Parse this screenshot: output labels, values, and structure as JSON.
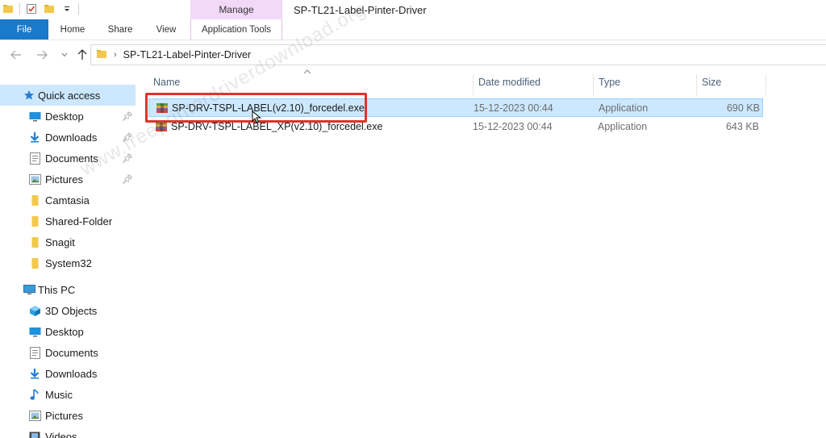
{
  "window": {
    "title": "SP-TL21-Label-Pinter-Driver",
    "context_tab_group": "Manage"
  },
  "ribbon": {
    "tabs": [
      {
        "label": "File"
      },
      {
        "label": "Home"
      },
      {
        "label": "Share"
      },
      {
        "label": "View"
      },
      {
        "label": "Application Tools"
      }
    ]
  },
  "address_bar": {
    "path": [
      "SP-TL21-Label-Pinter-Driver"
    ]
  },
  "nav_pane": {
    "quick_access": {
      "label": "Quick access"
    },
    "quick_items": [
      {
        "label": "Desktop",
        "icon": "desktop-icon",
        "pinned": true
      },
      {
        "label": "Downloads",
        "icon": "downloads-icon",
        "pinned": true
      },
      {
        "label": "Documents",
        "icon": "documents-icon",
        "pinned": true
      },
      {
        "label": "Pictures",
        "icon": "pictures-icon",
        "pinned": true
      },
      {
        "label": "Camtasia",
        "icon": "folder-icon",
        "pinned": false
      },
      {
        "label": "Shared-Folder",
        "icon": "folder-icon",
        "pinned": false
      },
      {
        "label": "Snagit",
        "icon": "folder-icon",
        "pinned": false
      },
      {
        "label": "System32",
        "icon": "folder-icon",
        "pinned": false
      }
    ],
    "this_pc": {
      "label": "This PC"
    },
    "pc_items": [
      {
        "label": "3D Objects",
        "icon": "3d-objects-icon"
      },
      {
        "label": "Desktop",
        "icon": "desktop-icon"
      },
      {
        "label": "Documents",
        "icon": "documents-icon"
      },
      {
        "label": "Downloads",
        "icon": "downloads-icon"
      },
      {
        "label": "Music",
        "icon": "music-icon"
      },
      {
        "label": "Pictures",
        "icon": "pictures-icon"
      },
      {
        "label": "Videos",
        "icon": "videos-icon"
      }
    ]
  },
  "file_list": {
    "columns": {
      "name": "Name",
      "date": "Date modified",
      "type": "Type",
      "size": "Size"
    },
    "rows": [
      {
        "name": "SP-DRV-TSPL-LABEL(v2.10)_forcedel.exe",
        "date": "15-12-2023 00:44",
        "type": "Application",
        "size": "690 KB",
        "selected": true
      },
      {
        "name": "SP-DRV-TSPL-LABEL_XP(v2.10)_forcedel.exe",
        "date": "15-12-2023 00:44",
        "type": "Application",
        "size": "643 KB",
        "selected": false
      }
    ]
  },
  "watermark": "www.freeprinterdriverdownload.org",
  "colors": {
    "accent": "#1979ca",
    "selection": "#cce8ff",
    "manage_tab": "#f2d9f7",
    "highlight": "#e0322b"
  }
}
